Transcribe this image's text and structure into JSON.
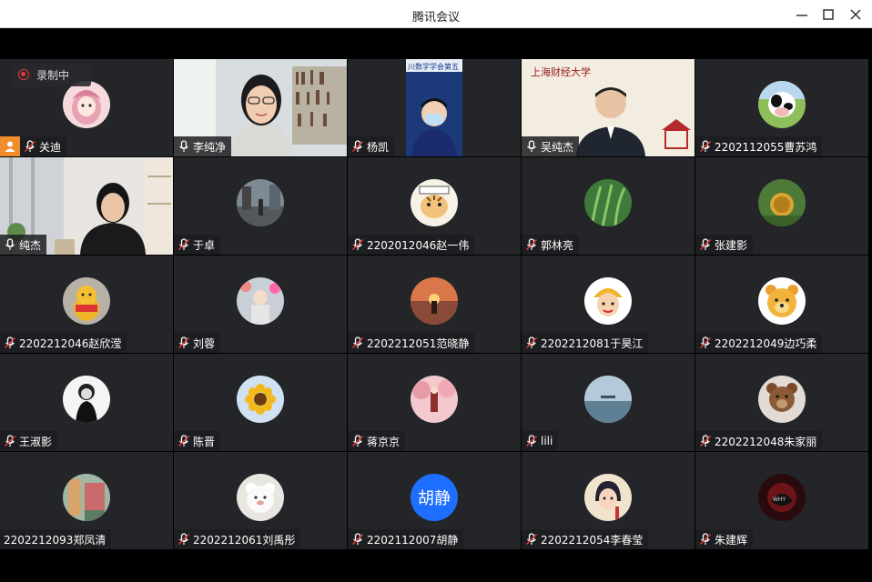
{
  "window": {
    "title": "腾讯会议"
  },
  "recording": {
    "label": "录制中"
  },
  "participants": [
    {
      "name": "关迪",
      "mic": "muted",
      "host": true,
      "avatar": "pink-hair-girl"
    },
    {
      "name": "李纯净",
      "mic": "on",
      "video": true,
      "active": true
    },
    {
      "name": "杨凯",
      "mic": "muted",
      "video": true,
      "banner": "川数学学会第五"
    },
    {
      "name": "吴纯杰",
      "mic": "on",
      "video": true,
      "banner": "上海财经大学"
    },
    {
      "name": "2202112055曹苏鸿",
      "mic": "muted",
      "avatar": "cow"
    },
    {
      "name": "纯杰",
      "mic": "on",
      "video": true
    },
    {
      "name": "于卓",
      "mic": "muted",
      "avatar": "street-photo"
    },
    {
      "name": "2202012046赵一伟",
      "mic": "muted",
      "avatar": "cartoon-tiger"
    },
    {
      "name": "郭林亮",
      "mic": "muted",
      "avatar": "green-grass"
    },
    {
      "name": "张建影",
      "mic": "muted",
      "avatar": "hobbit-house"
    },
    {
      "name": "2202212046赵欣滢",
      "mic": "muted",
      "avatar": "winnie-plush"
    },
    {
      "name": "刘蓉",
      "mic": "muted",
      "avatar": "person-flowers"
    },
    {
      "name": "2202212051范晓静",
      "mic": "muted",
      "avatar": "sunset"
    },
    {
      "name": "2202212081于昊江",
      "mic": "muted",
      "avatar": "cartoon-boy"
    },
    {
      "name": "2202212049边巧柔",
      "mic": "muted",
      "avatar": "pooh-face"
    },
    {
      "name": "王淑影",
      "mic": "muted",
      "avatar": "bw-portrait"
    },
    {
      "name": "陈晋",
      "mic": "muted",
      "avatar": "sunflower"
    },
    {
      "name": "蒋京京",
      "mic": "muted",
      "avatar": "pink-trees"
    },
    {
      "name": "lili",
      "mic": "muted",
      "avatar": "sea"
    },
    {
      "name": "2202212048朱家丽",
      "mic": "muted",
      "avatar": "teddy-bear"
    },
    {
      "name": "2202212093郑凤清",
      "mic": "none",
      "avatar": "anime-scene"
    },
    {
      "name": "2202212061刘禹彤",
      "mic": "muted",
      "avatar": "white-bear"
    },
    {
      "name": "2202112007胡静",
      "mic": "muted",
      "text_avatar": "胡静"
    },
    {
      "name": "2202212054李春莹",
      "mic": "muted",
      "avatar": "cartoon-girl"
    },
    {
      "name": "朱建辉",
      "mic": "muted",
      "avatar": "dark-red"
    }
  ],
  "colors": {
    "tile": "#232528",
    "active_border": "#3ccf6a",
    "host": "#f08c2a",
    "record_dot": "#e23b3b",
    "text_avatar": "#1e6fff"
  }
}
